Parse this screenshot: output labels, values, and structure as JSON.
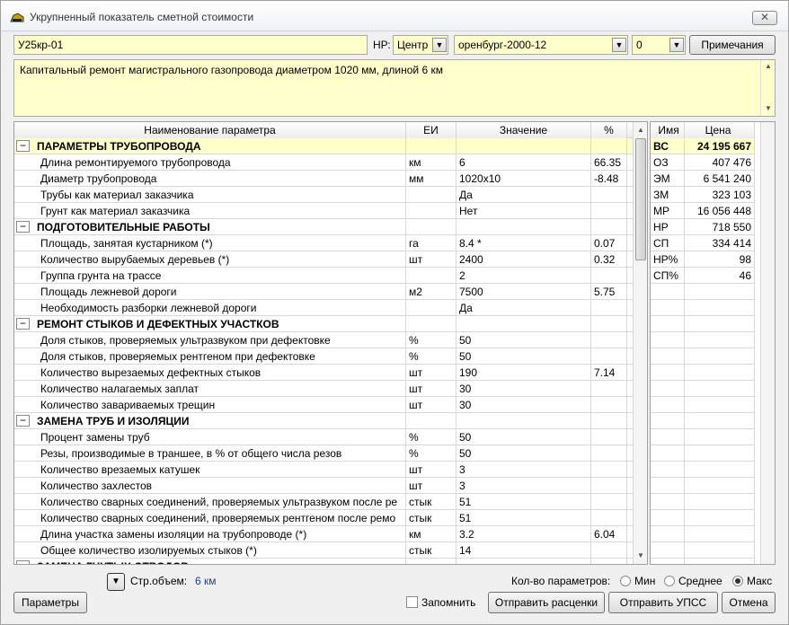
{
  "window": {
    "title": "Укрупненный показатель сметной стоимости",
    "close_label": "✕"
  },
  "top": {
    "code": "У25кр-01",
    "nr_label": "НР:",
    "nr_value": "Центр",
    "region": "оренбург-2000-12",
    "index": "0",
    "notes_button": "Примечания"
  },
  "description": "Капитальный ремонт магистрального газопровода диаметром 1020 мм, длиной 6 км",
  "grid": {
    "headers": [
      "Наименование параметра",
      "ЕИ",
      "Значение",
      "%"
    ],
    "rows": [
      {
        "section": true,
        "name": "ПАРАМЕТРЫ ТРУБОПРОВОДА",
        "unit": "",
        "value": "",
        "pct": "",
        "highlight": true
      },
      {
        "name": "Длина ремонтируемого трубопровода",
        "unit": "км",
        "value": "6",
        "pct": "66.35"
      },
      {
        "name": "Диаметр трубопровода",
        "unit": "мм",
        "value": "1020x10",
        "pct": "-8.48"
      },
      {
        "name": "Трубы как материал заказчика",
        "unit": "",
        "value": "Да",
        "pct": ""
      },
      {
        "name": "Грунт как материал заказчика",
        "unit": "",
        "value": "Нет",
        "pct": ""
      },
      {
        "section": true,
        "name": "ПОДГОТОВИТЕЛЬНЫЕ РАБОТЫ",
        "unit": "",
        "value": "",
        "pct": ""
      },
      {
        "name": "Площадь, занятая кустарником (*)",
        "unit": "га",
        "value": "8.4 *",
        "pct": "0.07"
      },
      {
        "name": "Количество вырубаемых деревьев (*)",
        "unit": "шт",
        "value": "2400",
        "pct": "0.32"
      },
      {
        "name": "Группа грунта на трассе",
        "unit": "",
        "value": "2",
        "pct": ""
      },
      {
        "name": "Площадь лежневой дороги",
        "unit": "м2",
        "value": "7500",
        "pct": "5.75"
      },
      {
        "name": "Необходимость разборки лежневой дороги",
        "unit": "",
        "value": "Да",
        "pct": ""
      },
      {
        "section": true,
        "name": "РЕМОНТ СТЫКОВ И ДЕФЕКТНЫХ УЧАСТКОВ",
        "unit": "",
        "value": "",
        "pct": ""
      },
      {
        "name": "Доля стыков, проверяемых ультразвуком при дефектовке",
        "unit": "%",
        "value": "50",
        "pct": ""
      },
      {
        "name": "Доля стыков, проверяемых рентгеном при дефектовке",
        "unit": "%",
        "value": "50",
        "pct": ""
      },
      {
        "name": "Количество вырезаемых дефектных стыков",
        "unit": "шт",
        "value": "190",
        "pct": "7.14"
      },
      {
        "name": "Количество налагаемых заплат",
        "unit": "шт",
        "value": "30",
        "pct": ""
      },
      {
        "name": "Количество завариваемых трещин",
        "unit": "шт",
        "value": "30",
        "pct": ""
      },
      {
        "section": true,
        "name": "ЗАМЕНА ТРУБ И ИЗОЛЯЦИИ",
        "unit": "",
        "value": "",
        "pct": ""
      },
      {
        "name": "Процент замены труб",
        "unit": "%",
        "value": "50",
        "pct": ""
      },
      {
        "name": "Резы, производимые в траншее, в % от общего числа резов",
        "unit": "%",
        "value": "50",
        "pct": ""
      },
      {
        "name": "Количество врезаемых катушек",
        "unit": "шт",
        "value": "3",
        "pct": ""
      },
      {
        "name": "Количество захлестов",
        "unit": "шт",
        "value": "3",
        "pct": ""
      },
      {
        "name": "Количество сварных соединений, проверяемых ультразвуком после ре",
        "unit": "стык",
        "value": "51",
        "pct": ""
      },
      {
        "name": "Количество сварных соединений, проверяемых рентгеном после ремо",
        "unit": "стык",
        "value": "51",
        "pct": ""
      },
      {
        "name": "Длина участка замены изоляции на трубопроводе (*)",
        "unit": "км",
        "value": "3.2",
        "pct": "6.04"
      },
      {
        "name": "Общее количество изолируемых стыков (*)",
        "unit": "стык",
        "value": "14",
        "pct": ""
      },
      {
        "section": true,
        "name": "ЗАМЕНА ГНУТЫХ ОТВОДОВ",
        "unit": "",
        "value": "",
        "pct": ""
      }
    ]
  },
  "prices": {
    "headers": [
      "Имя",
      "Цена"
    ],
    "rows": [
      {
        "name": "ВС",
        "value": "24 195 667",
        "bold": true
      },
      {
        "name": "ОЗ",
        "value": "407 476"
      },
      {
        "name": "ЭМ",
        "value": "6 541 240"
      },
      {
        "name": "ЗМ",
        "value": "323 103"
      },
      {
        "name": "МР",
        "value": "16 056 448"
      },
      {
        "name": "НР",
        "value": "718 550"
      },
      {
        "name": "СП",
        "value": "334 414"
      },
      {
        "name": "НР%",
        "value": "98"
      },
      {
        "name": "СП%",
        "value": "46"
      }
    ]
  },
  "bottom": {
    "str_label": "Стр.объем:",
    "str_value": "6 км",
    "params_count_label": "Кол-во параметров:",
    "radio_min": "Мин",
    "radio_avg": "Среднее",
    "radio_max": "Макс",
    "selected": "Макс",
    "params_button": "Параметры",
    "remember_label": "Запомнить",
    "send_prices_button": "Отправить расценки",
    "send_upss_button": "Отправить УПСС",
    "cancel_button": "Отмена"
  }
}
